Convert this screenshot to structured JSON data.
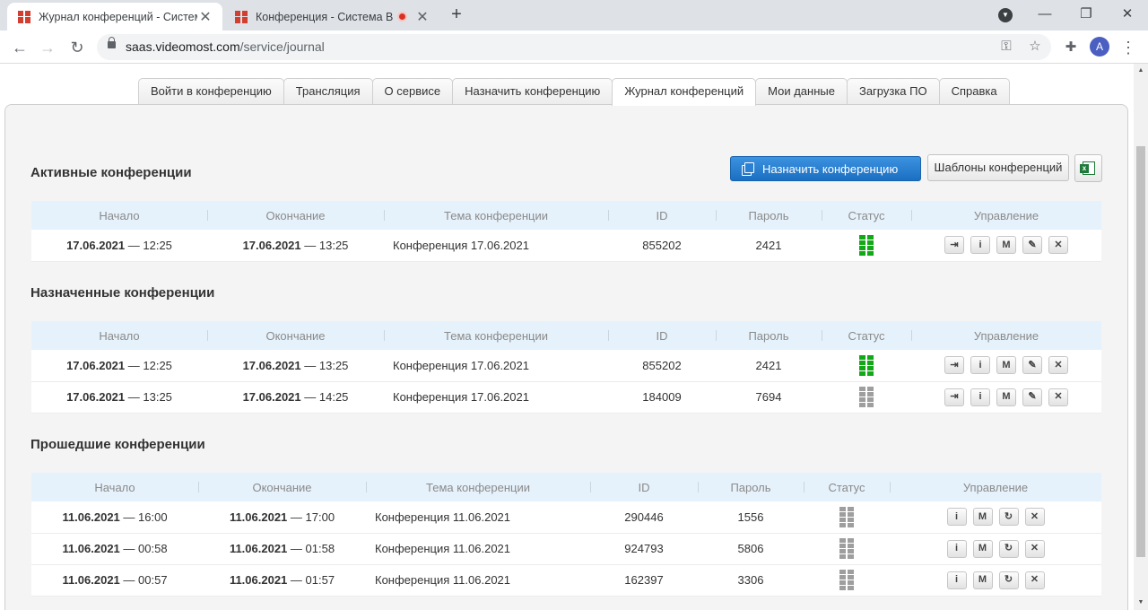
{
  "browser": {
    "tabs": [
      {
        "title": "Журнал конференций - Систем",
        "close": "✕"
      },
      {
        "title": "Конференция - Система ВК",
        "close": "✕"
      }
    ],
    "new_tab": "+",
    "profile_dd": "▼",
    "window": {
      "minimize": "—",
      "maximize": "❐",
      "close": "✕"
    },
    "nav": {
      "back": "←",
      "forward": "→",
      "reload": "↻"
    },
    "url": {
      "host": "saas.videomost.com",
      "path": "/service/journal"
    },
    "omnibox_icons": {
      "key": "⚿",
      "star": "☆"
    },
    "extensions_icon": "✚",
    "avatar": "A",
    "menu": "⋮",
    "scroll": {
      "up": "▲",
      "down": "▼"
    }
  },
  "site_tabs": [
    "Войти в конференцию",
    "Трансляция",
    "О сервисе",
    "Назначить конференцию",
    "Журнал конференций",
    "Мои данные",
    "Загрузка ПО",
    "Справка"
  ],
  "toolbar": {
    "schedule_label": "Назначить конференцию",
    "templates_label": "Шаблоны конференций"
  },
  "columns": [
    "Начало",
    "Окончание",
    "Тема конференции",
    "ID",
    "Пароль",
    "Статус",
    "Управление"
  ],
  "icons": {
    "enter": "⇥",
    "info": "i",
    "mail": "M",
    "edit": "✎",
    "delete": "✕",
    "repeat": "↻"
  },
  "sections": {
    "active": {
      "title": "Активные конференции",
      "rows": [
        {
          "start_date": "17.06.2021",
          "start_time": " — 12:25",
          "end_date": "17.06.2021",
          "end_time": " — 13:25",
          "topic": "Конференция 17.06.2021",
          "id": "855202",
          "password": "2421",
          "status": "active"
        }
      ]
    },
    "scheduled": {
      "title": "Назначенные конференции",
      "rows": [
        {
          "start_date": "17.06.2021",
          "start_time": " — 12:25",
          "end_date": "17.06.2021",
          "end_time": " — 13:25",
          "topic": "Конференция 17.06.2021",
          "id": "855202",
          "password": "2421",
          "status": "active"
        },
        {
          "start_date": "17.06.2021",
          "start_time": " — 13:25",
          "end_date": "17.06.2021",
          "end_time": " — 14:25",
          "topic": "Конференция 17.06.2021",
          "id": "184009",
          "password": "7694",
          "status": "inactive"
        }
      ]
    },
    "past": {
      "title": "Прошедшие конференции",
      "rows": [
        {
          "start_date": "11.06.2021",
          "start_time": " — 16:00",
          "end_date": "11.06.2021",
          "end_time": " — 17:00",
          "topic": "Конференция 11.06.2021",
          "id": "290446",
          "password": "1556",
          "status": "inactive"
        },
        {
          "start_date": "11.06.2021",
          "start_time": " — 00:58",
          "end_date": "11.06.2021",
          "end_time": " — 01:58",
          "topic": "Конференция 11.06.2021",
          "id": "924793",
          "password": "5806",
          "status": "inactive"
        },
        {
          "start_date": "11.06.2021",
          "start_time": " — 00:57",
          "end_date": "11.06.2021",
          "end_time": " — 01:57",
          "topic": "Конференция 11.06.2021",
          "id": "162397",
          "password": "3306",
          "status": "inactive"
        }
      ]
    }
  }
}
